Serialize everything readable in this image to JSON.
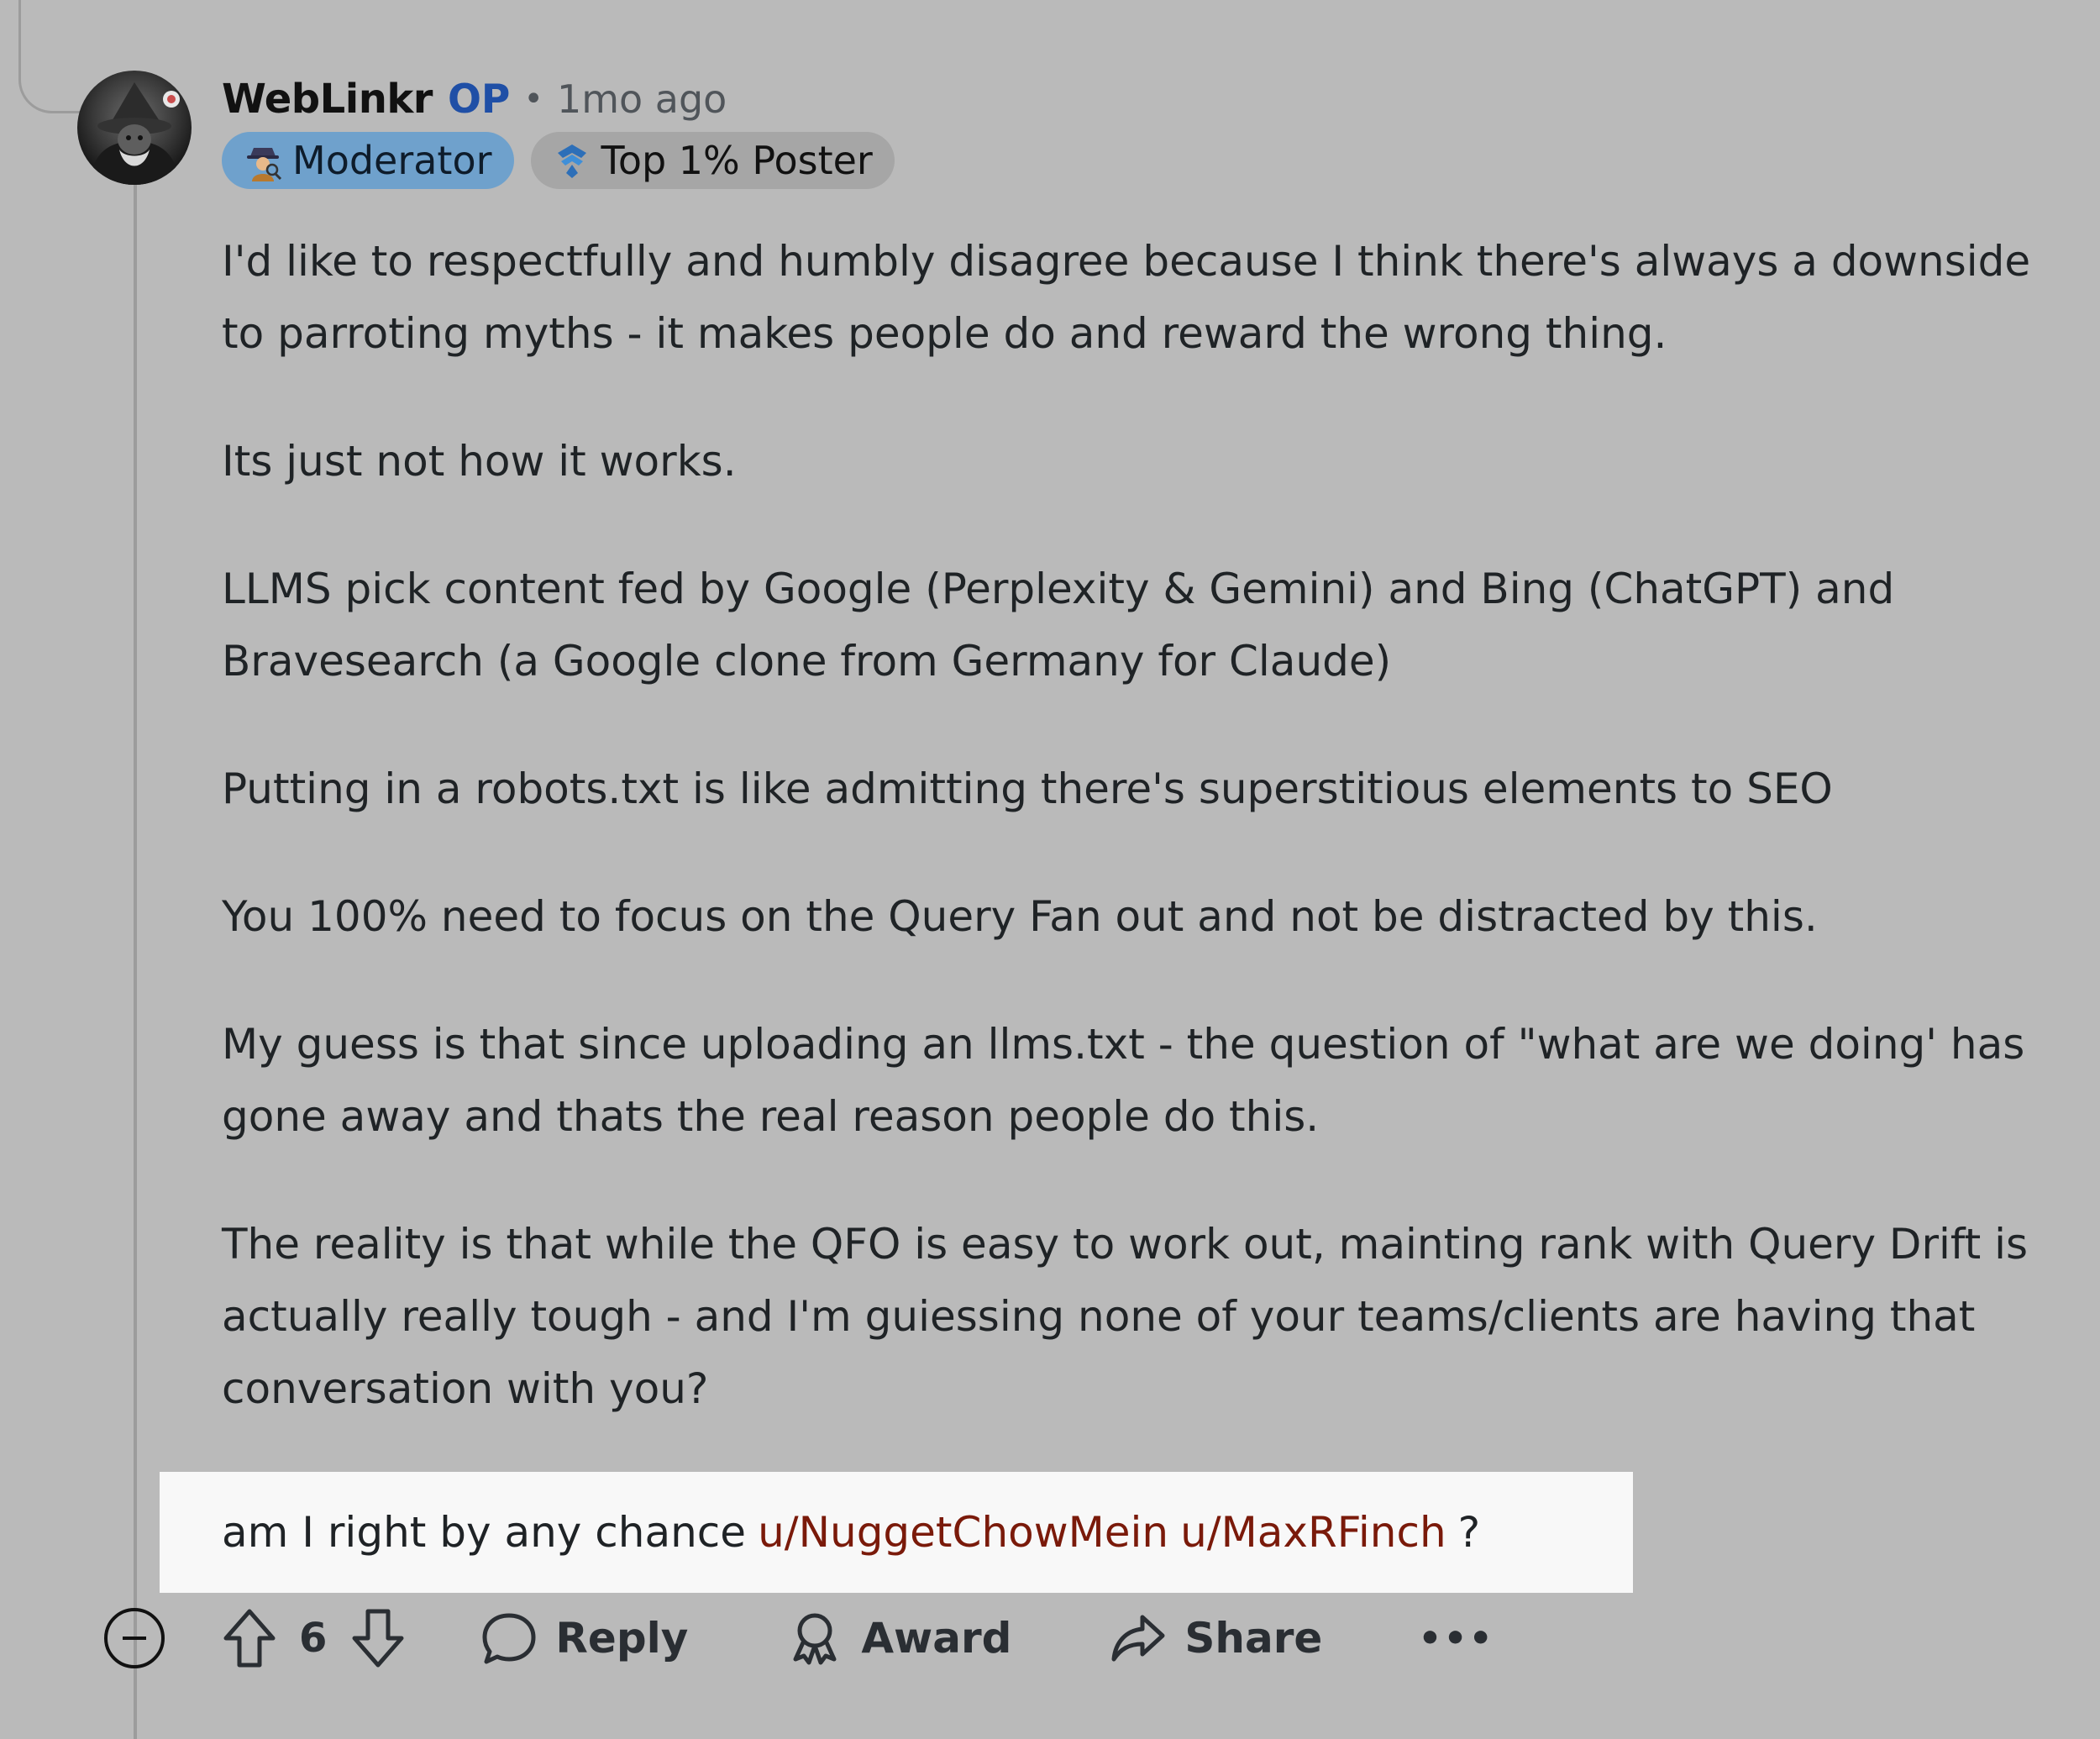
{
  "comment": {
    "username": "WebLinkr",
    "op_label": "OP",
    "separator": "•",
    "time": "1mo ago",
    "flairs": [
      {
        "label": "Moderator",
        "icon": "detective-icon"
      },
      {
        "label": "Top 1% Poster",
        "icon": "top-poster-icon"
      }
    ],
    "paragraphs": [
      "I'd like to respectfully and humbly disagree because I think there's always a downside to parroting myths - it makes people do and reward the wrong thing.",
      "Its just not how it works.",
      "LLMS pick content fed by Google (Perplexity & Gemini) and Bing (ChatGPT) and Bravesearch (a Google clone from Germany for Claude)",
      "Putting in a robots.txt is like admitting there's superstitious elements to SEO",
      "You 100% need to focus on the Query Fan out and not be distracted by this.",
      "My guess is that since uploading an llms.txt - the question of \"what are we doing' has gone away and thats the real reason people do this.",
      "The reality is that while the QFO is easy to work out, mainting rank with Query Drift is actually really tough - and I'm guiessing none of your teams/clients are having that conversation with you?"
    ],
    "highlight": {
      "text": "am I right by any chance",
      "mention_1": "u/NuggetChowMein",
      "mention_2": "u/MaxRFinch",
      "trailing": "?"
    }
  },
  "actions": {
    "score": "6",
    "reply": "Reply",
    "award": "Award",
    "share": "Share",
    "more": "•••"
  },
  "colors": {
    "background": "#bababa",
    "op": "#1f4fa6",
    "moderator_flair": "#6fa1cc",
    "mention": "#7a1a0a",
    "highlight_bg": "#f8f8f8"
  }
}
